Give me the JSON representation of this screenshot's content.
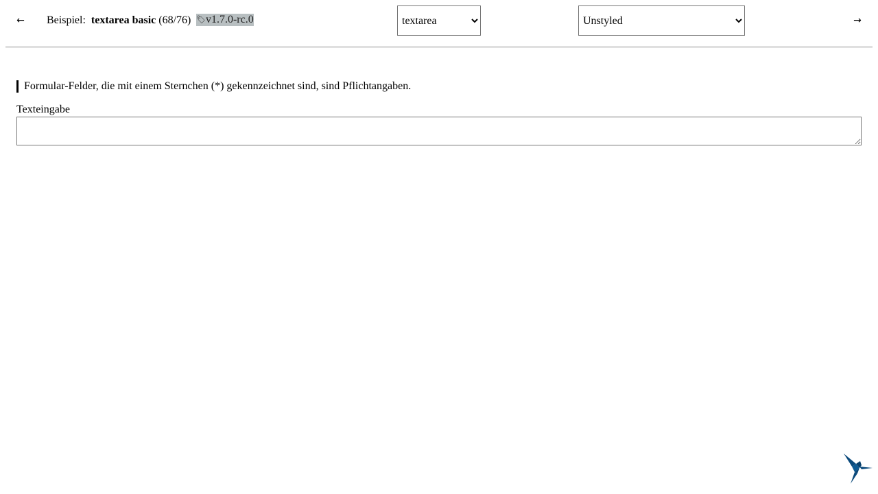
{
  "nav": {
    "prev_arrow": "←",
    "next_arrow": "→"
  },
  "breadcrumb": {
    "label": "Beispiel:",
    "example_name": "textarea basic",
    "counter": "(68/76)"
  },
  "version": {
    "icon": "🏷",
    "text": "v1.7.0-rc.0"
  },
  "component_select": {
    "selected": "textarea"
  },
  "theme_select": {
    "selected": "Unstyled"
  },
  "form": {
    "hint": "Formular-Felder, die mit einem Sternchen (*) gekennzeichnet sind, sind Pflichtangaben.",
    "textarea_label": "Texteingabe",
    "textarea_value": ""
  },
  "colors": {
    "version_badge_bg": "#b8bfc1",
    "logo_blue": "#0b4a7c"
  },
  "icons": {
    "logo": "hummingbird-logo-icon"
  }
}
